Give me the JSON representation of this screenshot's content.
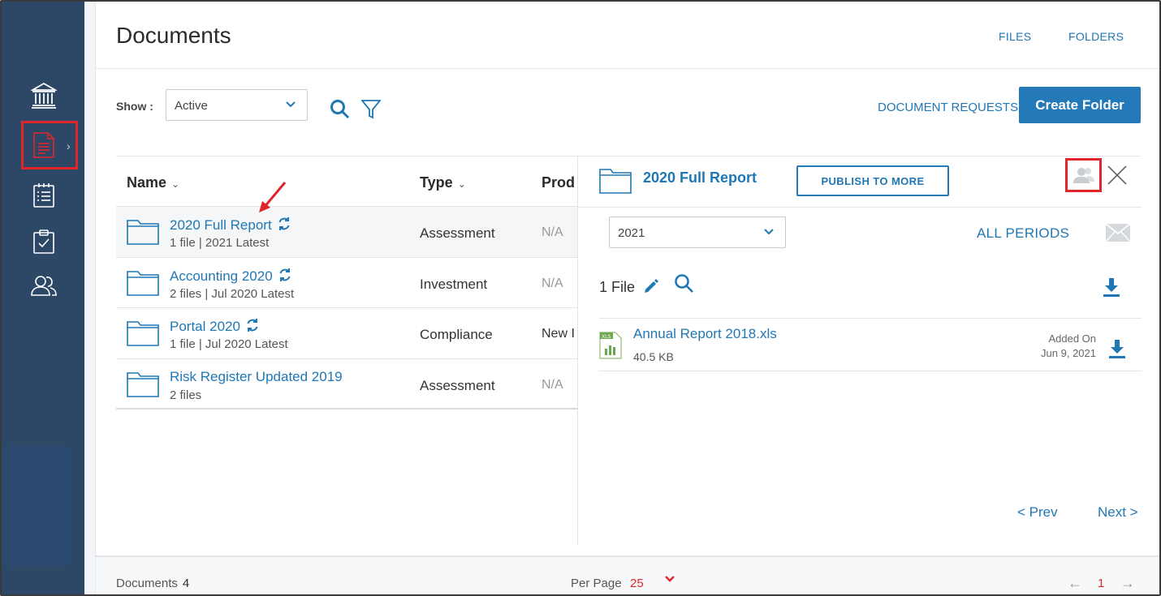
{
  "header": {
    "title": "Documents",
    "tabs": [
      {
        "label": "FILES"
      },
      {
        "label": "FOLDERS"
      }
    ]
  },
  "sidebar": {
    "items": [
      {
        "icon": "bank-icon"
      },
      {
        "icon": "document-icon",
        "active": true
      },
      {
        "icon": "checklist-icon"
      },
      {
        "icon": "clipboard-check-icon"
      },
      {
        "icon": "users-icon"
      }
    ]
  },
  "toolbar": {
    "show_label": "Show :",
    "show_value": "Active",
    "document_requests": "DOCUMENT REQUESTS",
    "create_folder": "Create Folder"
  },
  "table": {
    "columns": [
      {
        "label": "Name"
      },
      {
        "label": "Type"
      },
      {
        "label": "Prod"
      }
    ],
    "rows": [
      {
        "name": "2020 Full Report",
        "meta": "1 file | 2021 Latest",
        "type": "Assessment",
        "prod": "N/A",
        "sync": true
      },
      {
        "name": "Accounting 2020",
        "meta": "2 files | Jul 2020 Latest",
        "type": "Investment",
        "prod": "N/A",
        "sync": true
      },
      {
        "name": "Portal 2020",
        "meta": "1 file | Jul 2020 Latest",
        "type": "Compliance",
        "prod": "New I",
        "sync": true
      },
      {
        "name": "Risk Register Updated 2019",
        "meta": "2 files",
        "type": "Assessment",
        "prod": "N/A",
        "sync": false
      }
    ]
  },
  "panel": {
    "title": "2020 Full Report",
    "publish": "PUBLISH TO MORE",
    "period_value": "2021",
    "all_periods": "ALL PERIODS",
    "file_count": "1 File",
    "files": [
      {
        "name": "Annual Report 2018.xls",
        "size": "40.5 KB",
        "added_label": "Added On",
        "added_date": "Jun 9, 2021"
      }
    ],
    "prev": "< Prev",
    "next": "Next >"
  },
  "footer": {
    "documents_label": "Documents",
    "documents_count": "4",
    "per_page_label": "Per Page",
    "per_page_value": "25",
    "page": "1"
  },
  "colors": {
    "accent": "#1f77b4",
    "primary_button": "#2479b9",
    "sidebar": "#2d4766",
    "highlight": "#e0262b"
  }
}
